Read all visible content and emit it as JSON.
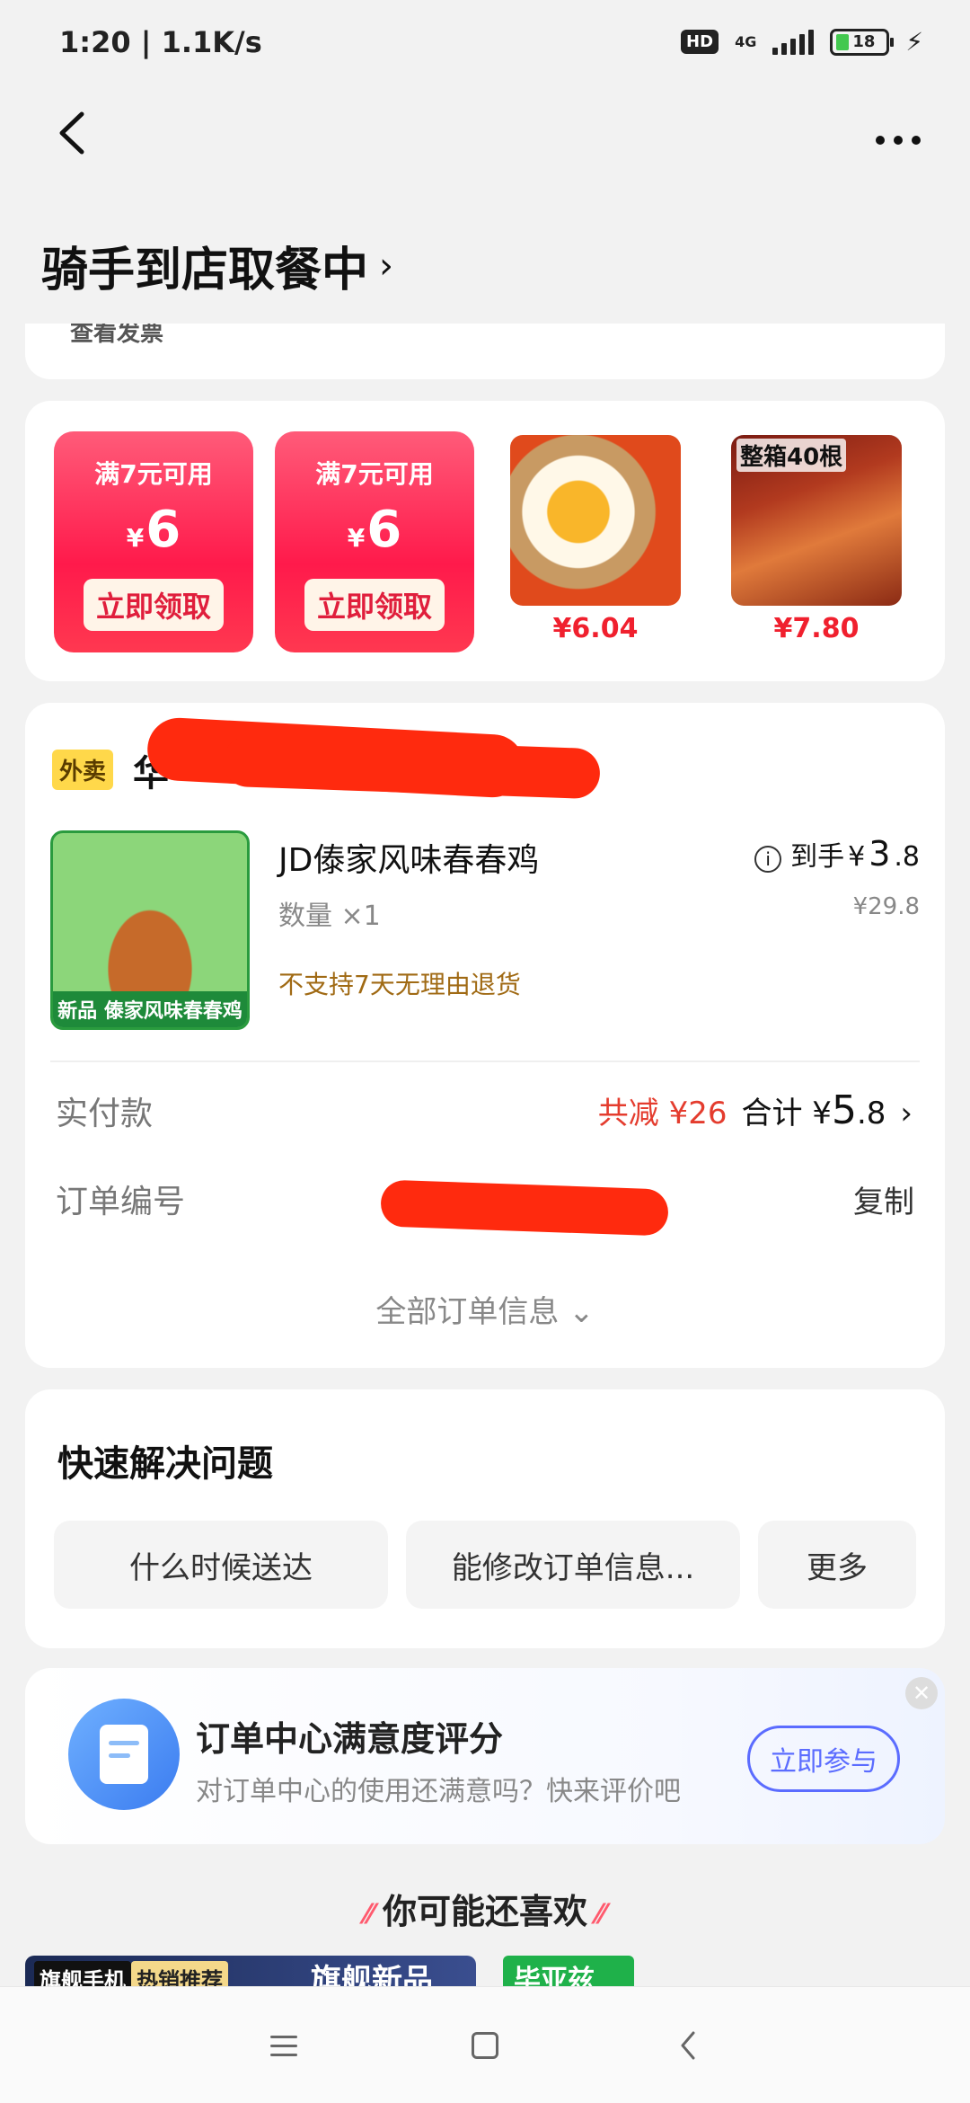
{
  "status_bar": {
    "time": "1:20 | 1.1K/s",
    "hd": "HD",
    "network": "4G",
    "battery": "18"
  },
  "header": {
    "back_icon": "chevron-left-icon",
    "more_icon": "more-dots-icon",
    "order_status": "骑手到店取餐中"
  },
  "top_card": {
    "invoice_link": "查看发票"
  },
  "promos": {
    "coupons": [
      {
        "condition": "满7元可用",
        "currency": "¥",
        "amount": "6",
        "button": "立即领取"
      },
      {
        "condition": "满7元可用",
        "currency": "¥",
        "amount": "6",
        "button": "立即领取"
      }
    ],
    "products": [
      {
        "price": "¥6.04",
        "image": "salted-egg-image"
      },
      {
        "price": "¥7.80",
        "image": "chicken-feet-image",
        "image_title": "整箱40根"
      }
    ]
  },
  "order": {
    "tag": "外卖",
    "shop_name": "华",
    "dish": {
      "name": "JD傣家风味春春鸡",
      "badge": "新品 傣家风味春春鸡",
      "quantity": "数量 ×1",
      "return_policy": "不支持7天无理由退货",
      "paid_label": "到手",
      "paid_currency": "¥",
      "paid_int": "3",
      "paid_dec": ".8",
      "original_price": "¥29.8"
    },
    "actual_payment_label": "实付款",
    "discount": "共减 ¥26",
    "total_label": "合计 ¥",
    "total_int": "5",
    "total_dec": ".8",
    "order_number_label": "订单编号",
    "copy_label": "复制",
    "all_info": "全部订单信息"
  },
  "quick_help": {
    "title": "快速解决问题",
    "chips": [
      "什么时候送达",
      "能修改订单信息...",
      "更多"
    ]
  },
  "survey": {
    "title": "订单中心满意度评分",
    "subtitle": "对订单中心的使用还满意吗？快来评价吧",
    "button": "立即参与"
  },
  "recommend": {
    "title": "你可能还喜欢",
    "tag1": "旗舰手机",
    "tag2": "热销推荐",
    "headline": "旗舰新品",
    "brand": "毕亚兹"
  }
}
